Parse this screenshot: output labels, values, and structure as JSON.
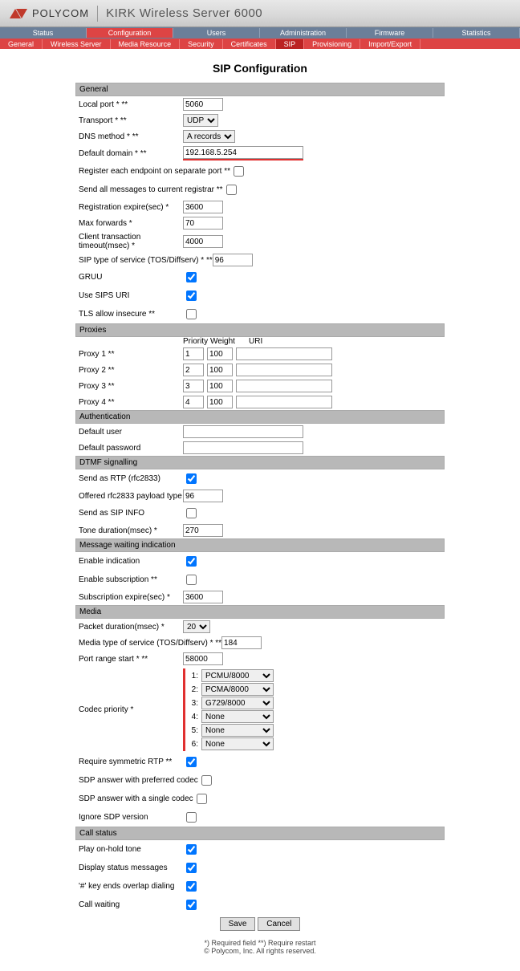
{
  "header": {
    "brand": "POLYCOM",
    "product": "KIRK Wireless Server 6000"
  },
  "nav1": [
    "Status",
    "Configuration",
    "Users",
    "Administration",
    "Firmware",
    "Statistics"
  ],
  "nav1_active": 1,
  "nav2": [
    "General",
    "Wireless Server",
    "Media Resource",
    "Security",
    "Certificates",
    "SIP",
    "Provisioning",
    "Import/Export"
  ],
  "nav2_active": 5,
  "title": "SIP Configuration",
  "sections": {
    "general": {
      "header": "General",
      "local_port": {
        "label": "Local port * **",
        "value": "5060"
      },
      "transport": {
        "label": "Transport * **",
        "value": "UDP"
      },
      "dns_method": {
        "label": "DNS method * **",
        "value": "A records"
      },
      "default_domain": {
        "label": "Default domain * **",
        "value": "192.168.5.254"
      },
      "register_sep": {
        "label": "Register each endpoint on separate port **",
        "checked": false
      },
      "send_all": {
        "label": "Send all messages to current registrar **",
        "checked": false
      },
      "reg_expire": {
        "label": "Registration expire(sec) *",
        "value": "3600"
      },
      "max_forwards": {
        "label": "Max forwards *",
        "value": "70"
      },
      "client_timeout": {
        "label": "Client transaction timeout(msec) *",
        "value": "4000"
      },
      "sip_tos": {
        "label": "SIP type of service (TOS/Diffserv) * **",
        "value": "96"
      },
      "gruu": {
        "label": "GRUU",
        "checked": true
      },
      "use_sips": {
        "label": "Use SIPS URI",
        "checked": true
      },
      "tls_insecure": {
        "label": "TLS allow insecure **",
        "checked": false
      }
    },
    "proxies": {
      "header": "Proxies",
      "cols": {
        "priority": "Priority",
        "weight": "Weight",
        "uri": "URI"
      },
      "rows": [
        {
          "label": "Proxy 1 **",
          "priority": "1",
          "weight": "100",
          "uri": ""
        },
        {
          "label": "Proxy 2 **",
          "priority": "2",
          "weight": "100",
          "uri": ""
        },
        {
          "label": "Proxy 3 **",
          "priority": "3",
          "weight": "100",
          "uri": ""
        },
        {
          "label": "Proxy 4 **",
          "priority": "4",
          "weight": "100",
          "uri": ""
        }
      ]
    },
    "auth": {
      "header": "Authentication",
      "default_user": {
        "label": "Default user",
        "value": ""
      },
      "default_pass": {
        "label": "Default password",
        "value": ""
      }
    },
    "dtmf": {
      "header": "DTMF signalling",
      "send_rtp": {
        "label": "Send as RTP (rfc2833)",
        "checked": true
      },
      "payload": {
        "label": "Offered rfc2833 payload type",
        "value": "96"
      },
      "sip_info": {
        "label": "Send as SIP INFO",
        "checked": false
      },
      "tone_dur": {
        "label": "Tone duration(msec) *",
        "value": "270"
      }
    },
    "mwi": {
      "header": "Message waiting indication",
      "enable_ind": {
        "label": "Enable indication",
        "checked": true
      },
      "enable_sub": {
        "label": "Enable subscription **",
        "checked": false
      },
      "sub_expire": {
        "label": "Subscription expire(sec) *",
        "value": "3600"
      }
    },
    "media": {
      "header": "Media",
      "packet_dur": {
        "label": "Packet duration(msec) *",
        "value": "20"
      },
      "media_tos": {
        "label": "Media type of service (TOS/Diffserv) * **",
        "value": "184"
      },
      "port_range": {
        "label": "Port range start * **",
        "value": "58000"
      },
      "codec": {
        "label": "Codec priority *",
        "values": [
          "PCMU/8000",
          "PCMA/8000",
          "G729/8000",
          "None",
          "None",
          "None"
        ]
      },
      "req_sym": {
        "label": "Require symmetric RTP **",
        "checked": true
      },
      "sdp_pref": {
        "label": "SDP answer with preferred codec",
        "checked": false
      },
      "sdp_single": {
        "label": "SDP answer with a single codec",
        "checked": false
      },
      "ignore_sdp": {
        "label": "Ignore SDP version",
        "checked": false
      }
    },
    "call": {
      "header": "Call status",
      "hold_tone": {
        "label": "Play on-hold tone",
        "checked": true
      },
      "disp_status": {
        "label": "Display status messages",
        "checked": true
      },
      "hash_overlap": {
        "label": "'#' key ends overlap dialing",
        "checked": true
      },
      "call_wait": {
        "label": "Call waiting",
        "checked": true
      }
    }
  },
  "buttons": {
    "save": "Save",
    "cancel": "Cancel"
  },
  "footnotes": {
    "req": "*) Required field **) Require restart",
    "copy": "© Polycom, Inc. All rights reserved."
  }
}
